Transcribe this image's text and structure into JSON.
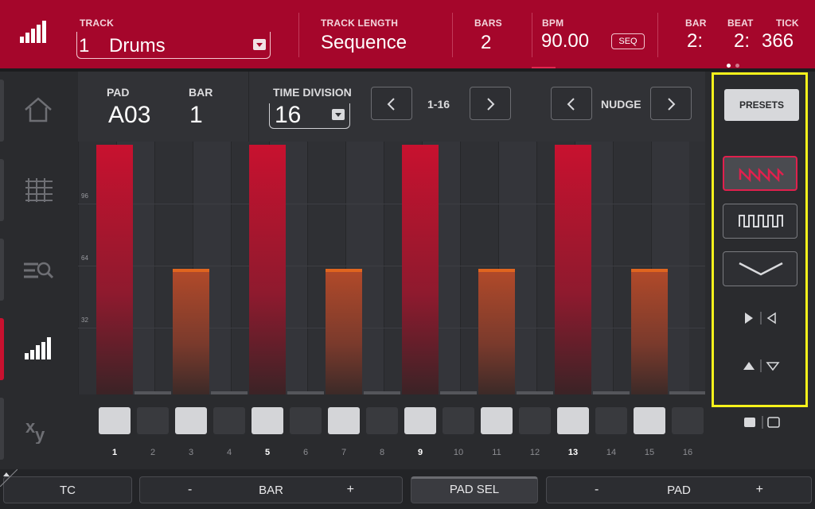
{
  "header": {
    "track_label": "TRACK",
    "track_number": "1",
    "track_name": "Drums",
    "track_length_label": "TRACK LENGTH",
    "track_length_value": "Sequence",
    "bars_label": "BARS",
    "bars_value": "2",
    "bpm_label": "BPM",
    "bpm_value": "90.00",
    "seq_badge": "SEQ",
    "bar_label": "BAR",
    "bar_value": "2:",
    "beat_label": "BEAT",
    "beat_value": "2:",
    "tick_label": "TICK",
    "tick_value": "366"
  },
  "sidebar": {
    "items": [
      {
        "name": "home",
        "active": false
      },
      {
        "name": "grid",
        "active": false
      },
      {
        "name": "browse",
        "active": false
      },
      {
        "name": "step-edit",
        "active": true
      },
      {
        "name": "xy",
        "active": false
      }
    ]
  },
  "controls": {
    "pad_label": "PAD",
    "pad_value": "A03",
    "bar_label": "BAR",
    "bar_value": "1",
    "time_division_label": "TIME DIVISION",
    "time_division_value": "16",
    "range_label": "1-16",
    "nudge_label": "NUDGE"
  },
  "grid": {
    "y_ticks": [
      "96",
      "64",
      "32"
    ]
  },
  "chart_data": {
    "type": "bar",
    "categories": [
      "1",
      "2",
      "3",
      "4",
      "5",
      "6",
      "7",
      "8",
      "9",
      "10",
      "11",
      "12",
      "13",
      "14",
      "15",
      "16"
    ],
    "values": [
      127,
      0,
      64,
      0,
      127,
      0,
      64,
      0,
      127,
      0,
      64,
      0,
      127,
      0,
      64,
      0
    ],
    "ylim": [
      0,
      127
    ],
    "colors": {
      "high": "#c8112f",
      "mid": "#e0651f"
    }
  },
  "pads": {
    "steps": [
      {
        "num": "1",
        "on": true,
        "strong": true
      },
      {
        "num": "2",
        "on": false,
        "strong": false
      },
      {
        "num": "3",
        "on": true,
        "strong": false
      },
      {
        "num": "4",
        "on": false,
        "strong": false
      },
      {
        "num": "5",
        "on": true,
        "strong": true
      },
      {
        "num": "6",
        "on": false,
        "strong": false
      },
      {
        "num": "7",
        "on": true,
        "strong": false
      },
      {
        "num": "8",
        "on": false,
        "strong": false
      },
      {
        "num": "9",
        "on": true,
        "strong": true
      },
      {
        "num": "10",
        "on": false,
        "strong": false
      },
      {
        "num": "11",
        "on": true,
        "strong": false
      },
      {
        "num": "12",
        "on": false,
        "strong": false
      },
      {
        "num": "13",
        "on": true,
        "strong": true
      },
      {
        "num": "14",
        "on": false,
        "strong": false
      },
      {
        "num": "15",
        "on": true,
        "strong": false
      },
      {
        "num": "16",
        "on": false,
        "strong": false
      }
    ]
  },
  "right_panel": {
    "presets_label": "PRESETS",
    "shapes": [
      "sawtooth-wave",
      "square-wave",
      "valley-curve"
    ],
    "active_shape": "sawtooth-wave"
  },
  "footer": {
    "tc_label": "TC",
    "bar_label": "BAR",
    "pad_sel_label": "PAD SEL",
    "pad_label": "PAD",
    "minus": "-",
    "plus": "+"
  },
  "colors": {
    "brand": "#a5062b",
    "accent": "#e0204d",
    "highlight": "#f6f21b"
  }
}
